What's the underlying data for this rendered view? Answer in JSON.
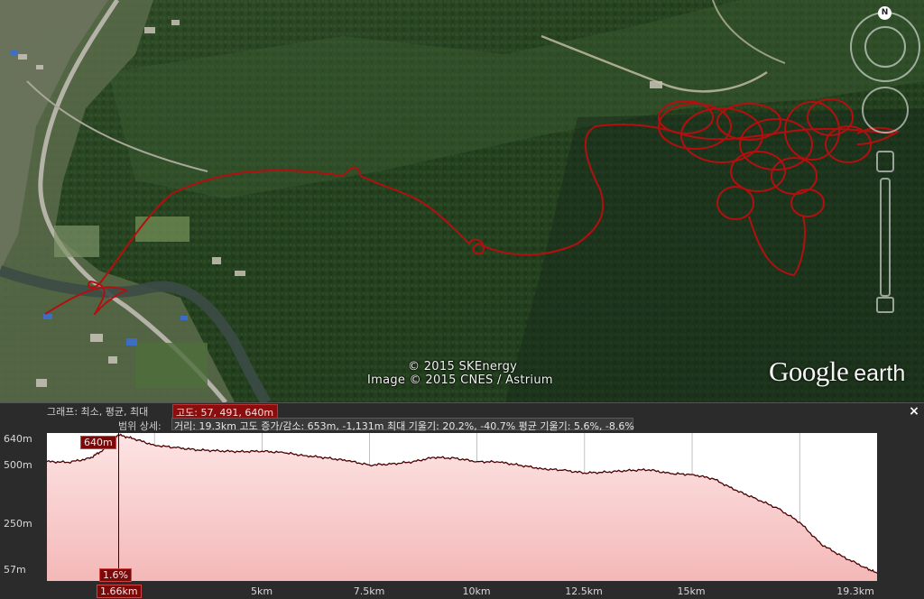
{
  "map": {
    "attribution_1": "© 2015 SKEnergy",
    "attribution_2": "Image © 2015 CNES / Astrium",
    "logo_word_1": "Google",
    "logo_word_2": "earth",
    "compass_label": "N",
    "track_color": "#b30f0f"
  },
  "profile": {
    "row1_label": "그래프: 최소, 평균, 최대",
    "row1_value": "고도: 57, 491, 640m",
    "row2_label": "범위 상세:",
    "row2_value": "거리: 19.3km 고도 증가/감소: 653m, -1,131m 최대 기울기: 20.2%, -40.7% 평균 기울기: 5.6%, -8.6%",
    "close_label": "×",
    "cursor_elevation": "640m",
    "cursor_slope": "1.6%",
    "cursor_distance": "1.66km",
    "y_ticks": [
      "640m",
      "500m",
      "250m",
      "57m"
    ],
    "x_ticks": [
      "5km",
      "7.5km",
      "10km",
      "12.5km",
      "15km",
      "19.3km"
    ],
    "fill_color": "#f4b8b8",
    "line_color": "#4a0000"
  },
  "chart_data": {
    "type": "area",
    "xlabel": "",
    "ylabel": "",
    "ylim": [
      57,
      640
    ],
    "xlim": [
      0,
      19.3
    ],
    "x": [
      0,
      0.5,
      1.0,
      1.3,
      1.66,
      2.0,
      2.5,
      3.0,
      3.5,
      4.0,
      4.5,
      5.0,
      5.5,
      6.0,
      6.5,
      7.0,
      7.5,
      8.0,
      8.5,
      9.0,
      9.5,
      10.0,
      10.5,
      11.0,
      11.5,
      12.0,
      12.5,
      13.0,
      13.5,
      14.0,
      14.5,
      15.0,
      15.5,
      16.0,
      16.5,
      17.0,
      17.5,
      18.0,
      18.5,
      19.0,
      19.3
    ],
    "y": [
      532,
      529,
      545,
      578,
      640,
      625,
      598,
      588,
      579,
      575,
      572,
      574,
      568,
      556,
      547,
      535,
      518,
      522,
      531,
      549,
      545,
      532,
      530,
      517,
      503,
      497,
      486,
      489,
      496,
      499,
      483,
      480,
      462,
      417,
      381,
      342,
      287,
      198,
      148,
      106,
      81
    ]
  }
}
